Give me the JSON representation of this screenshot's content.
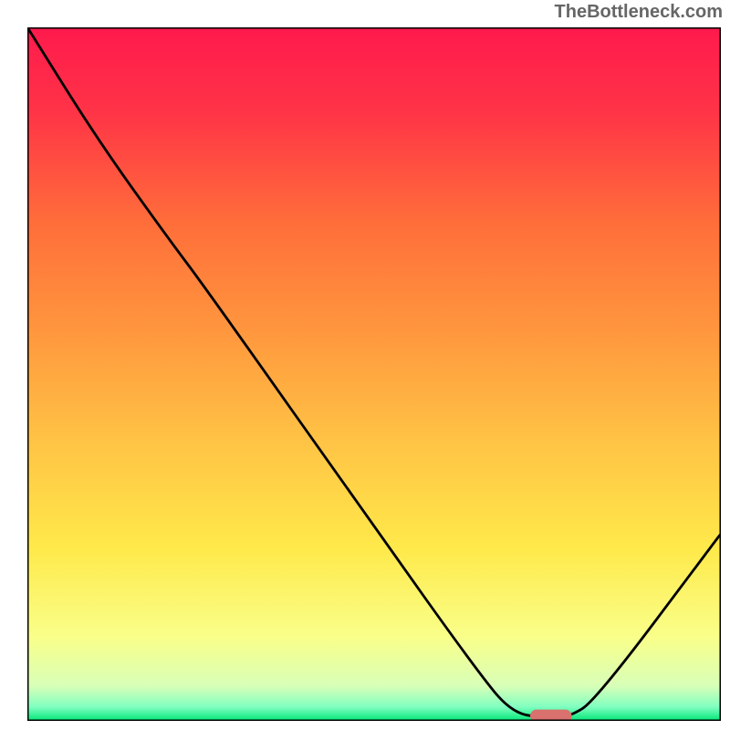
{
  "watermark": "TheBottleneck.com",
  "chart_data": {
    "type": "line",
    "title": "",
    "xlabel": "",
    "ylabel": "",
    "xlim": [
      0,
      100
    ],
    "ylim": [
      0,
      100
    ],
    "gradient_colors": {
      "top": "#ff1744",
      "mid_upper": "#ff6d3a",
      "mid": "#ffb340",
      "mid_lower": "#ffe94a",
      "lower": "#f9ff8a",
      "bottom": "#00e676"
    },
    "curve_points": [
      {
        "x": 0,
        "y": 100
      },
      {
        "x": 10,
        "y": 84
      },
      {
        "x": 20,
        "y": 70
      },
      {
        "x": 26,
        "y": 62
      },
      {
        "x": 50,
        "y": 28
      },
      {
        "x": 65,
        "y": 7
      },
      {
        "x": 70,
        "y": 1
      },
      {
        "x": 75,
        "y": 0.5
      },
      {
        "x": 78,
        "y": 0.5
      },
      {
        "x": 82,
        "y": 3
      },
      {
        "x": 100,
        "y": 27
      }
    ],
    "marker": {
      "x": 75.5,
      "y": 0.7,
      "width": 6,
      "color": "#d9716e"
    }
  }
}
